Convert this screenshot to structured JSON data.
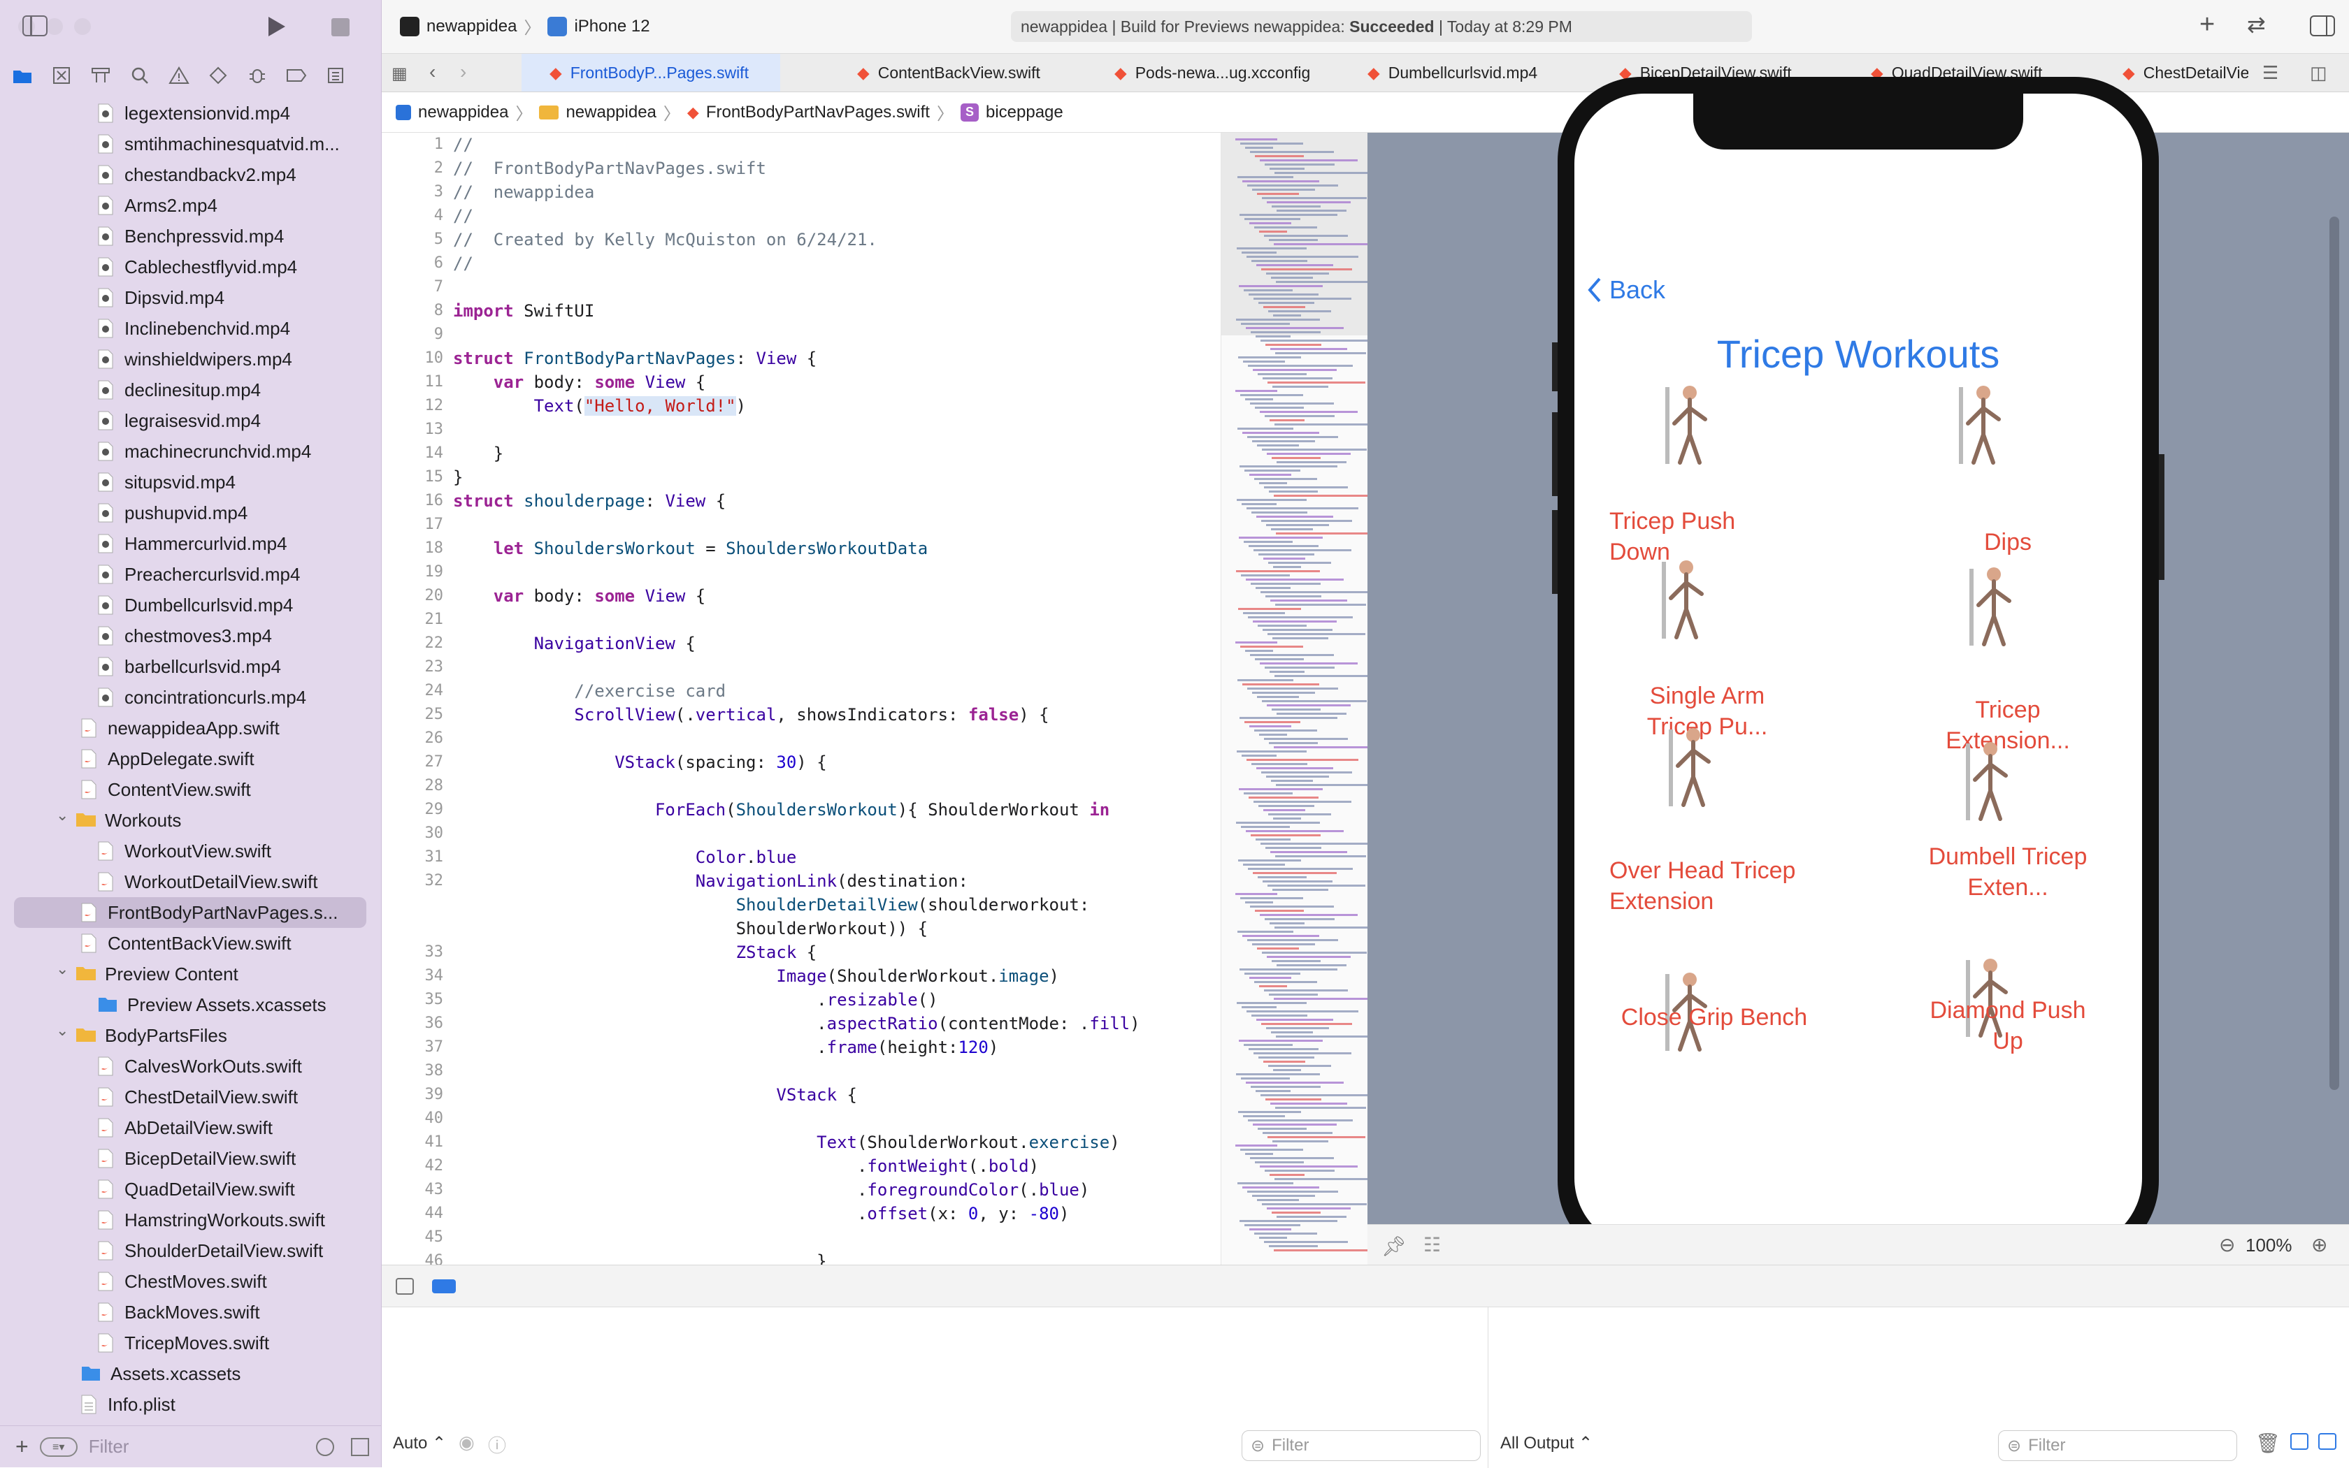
{
  "toolbar": {
    "scheme": "newappidea",
    "device": "iPhone 12",
    "status_prefix": "newappidea | Build for Previews newappidea: ",
    "status_result": "Succeeded",
    "status_suffix": " | Today at 8:29 PM"
  },
  "tabs": [
    {
      "label": "FrontBodyP...Pages.swift",
      "active": true
    },
    {
      "label": "ContentBackView.swift"
    },
    {
      "label": "Pods-newa...ug.xcconfig"
    },
    {
      "label": "Dumbellcurlsvid.mp4"
    },
    {
      "label": "BicepDetailView.swift"
    },
    {
      "label": "QuadDetailView.swift"
    },
    {
      "label": "ChestDetailView.swift"
    }
  ],
  "jumpbar": {
    "project": "newappidea",
    "group": "newappidea",
    "file": "FrontBodyPartNavPages.swift",
    "symbol": "biceppage",
    "symbol_badge": "S"
  },
  "navigator": {
    "items": [
      {
        "label": "legextensionvid.mp4",
        "kind": "video",
        "indent": 2
      },
      {
        "label": "smtihmachinesquatvid.m...",
        "kind": "video",
        "indent": 2
      },
      {
        "label": "chestandbackv2.mp4",
        "kind": "video",
        "indent": 2
      },
      {
        "label": "Arms2.mp4",
        "kind": "video",
        "indent": 2
      },
      {
        "label": "Benchpressvid.mp4",
        "kind": "video",
        "indent": 2
      },
      {
        "label": "Cablechestflyvid.mp4",
        "kind": "video",
        "indent": 2
      },
      {
        "label": "Dipsvid.mp4",
        "kind": "video",
        "indent": 2
      },
      {
        "label": "Inclinebenchvid.mp4",
        "kind": "video",
        "indent": 2
      },
      {
        "label": "winshieldwipers.mp4",
        "kind": "video",
        "indent": 2
      },
      {
        "label": "declinesitup.mp4",
        "kind": "video",
        "indent": 2
      },
      {
        "label": "legraisesvid.mp4",
        "kind": "video",
        "indent": 2
      },
      {
        "label": "machinecrunchvid.mp4",
        "kind": "video",
        "indent": 2
      },
      {
        "label": "situpsvid.mp4",
        "kind": "video",
        "indent": 2
      },
      {
        "label": "pushupvid.mp4",
        "kind": "video",
        "indent": 2
      },
      {
        "label": "Hammercurlvid.mp4",
        "kind": "video",
        "indent": 2
      },
      {
        "label": "Preachercurlsvid.mp4",
        "kind": "video",
        "indent": 2
      },
      {
        "label": "Dumbellcurlsvid.mp4",
        "kind": "video",
        "indent": 2
      },
      {
        "label": "chestmoves3.mp4",
        "kind": "video",
        "indent": 2
      },
      {
        "label": "barbellcurlsvid.mp4",
        "kind": "video",
        "indent": 2
      },
      {
        "label": "concintrationcurls.mp4",
        "kind": "video",
        "indent": 2
      },
      {
        "label": "newappideaApp.swift",
        "kind": "swift",
        "indent": 1
      },
      {
        "label": "AppDelegate.swift",
        "kind": "swift",
        "indent": 1
      },
      {
        "label": "ContentView.swift",
        "kind": "swift",
        "indent": 1
      },
      {
        "label": "Workouts",
        "kind": "folder",
        "indent": 1
      },
      {
        "label": "WorkoutView.swift",
        "kind": "swift",
        "indent": 2
      },
      {
        "label": "WorkoutDetailView.swift",
        "kind": "swift",
        "indent": 2
      },
      {
        "label": "FrontBodyPartNavPages.s...",
        "kind": "swift",
        "indent": 1,
        "selected": true
      },
      {
        "label": "ContentBackView.swift",
        "kind": "swift",
        "indent": 1
      },
      {
        "label": "Preview Content",
        "kind": "folder",
        "indent": 1
      },
      {
        "label": "Preview Assets.xcassets",
        "kind": "assets",
        "indent": 2
      },
      {
        "label": "BodyPartsFiles",
        "kind": "folder",
        "indent": 1
      },
      {
        "label": "CalvesWorkOuts.swift",
        "kind": "swift",
        "indent": 2
      },
      {
        "label": "ChestDetailView.swift",
        "kind": "swift",
        "indent": 2
      },
      {
        "label": "AbDetailView.swift",
        "kind": "swift",
        "indent": 2
      },
      {
        "label": "BicepDetailView.swift",
        "kind": "swift",
        "indent": 2
      },
      {
        "label": "QuadDetailView.swift",
        "kind": "swift",
        "indent": 2
      },
      {
        "label": "HamstringWorkouts.swift",
        "kind": "swift",
        "indent": 2
      },
      {
        "label": "ShoulderDetailView.swift",
        "kind": "swift",
        "indent": 2
      },
      {
        "label": "ChestMoves.swift",
        "kind": "swift",
        "indent": 2
      },
      {
        "label": "BackMoves.swift",
        "kind": "swift",
        "indent": 2
      },
      {
        "label": "TricepMoves.swift",
        "kind": "swift",
        "indent": 2
      },
      {
        "label": "Assets.xcassets",
        "kind": "assets",
        "indent": 1
      },
      {
        "label": "Info.plist",
        "kind": "plist",
        "indent": 1
      }
    ],
    "filter_placeholder": "Filter"
  },
  "code": {
    "line_numbers": [
      "1",
      "2",
      "3",
      "4",
      "5",
      "6",
      "7",
      "8",
      "9",
      "10",
      "11",
      "12",
      "13",
      "14",
      "15",
      "16",
      "17",
      "18",
      "19",
      "20",
      "21",
      "22",
      "23",
      "24",
      "25",
      "26",
      "27",
      "28",
      "29",
      "30",
      "31",
      "32",
      "",
      "",
      "33",
      "34",
      "35",
      "36",
      "37",
      "38",
      "39",
      "40",
      "41",
      "42",
      "43",
      "44",
      "45",
      "46"
    ]
  },
  "preview": {
    "back_label": "Back",
    "title": "Tricep Workouts",
    "workouts": [
      {
        "name": "Tricep Push Down"
      },
      {
        "name": "Dips"
      },
      {
        "name": "Single Arm Tricep Pu..."
      },
      {
        "name": "Tricep Extension..."
      },
      {
        "name": "Over Head Tricep Extension"
      },
      {
        "name": "Dumbell Tricep Exten..."
      },
      {
        "name": "Close Grip Bench"
      },
      {
        "name": "Diamond Push Up"
      }
    ],
    "zoom": "100%"
  },
  "debug": {
    "mode": "Auto",
    "output": "All Output",
    "filter_placeholder": "Filter"
  },
  "colors": {
    "ios_blue": "#2f7ae5",
    "ios_red": "#e34b3b",
    "sidebar_bg": "#e3d8ec",
    "selected_row": "#c9bcd5"
  }
}
